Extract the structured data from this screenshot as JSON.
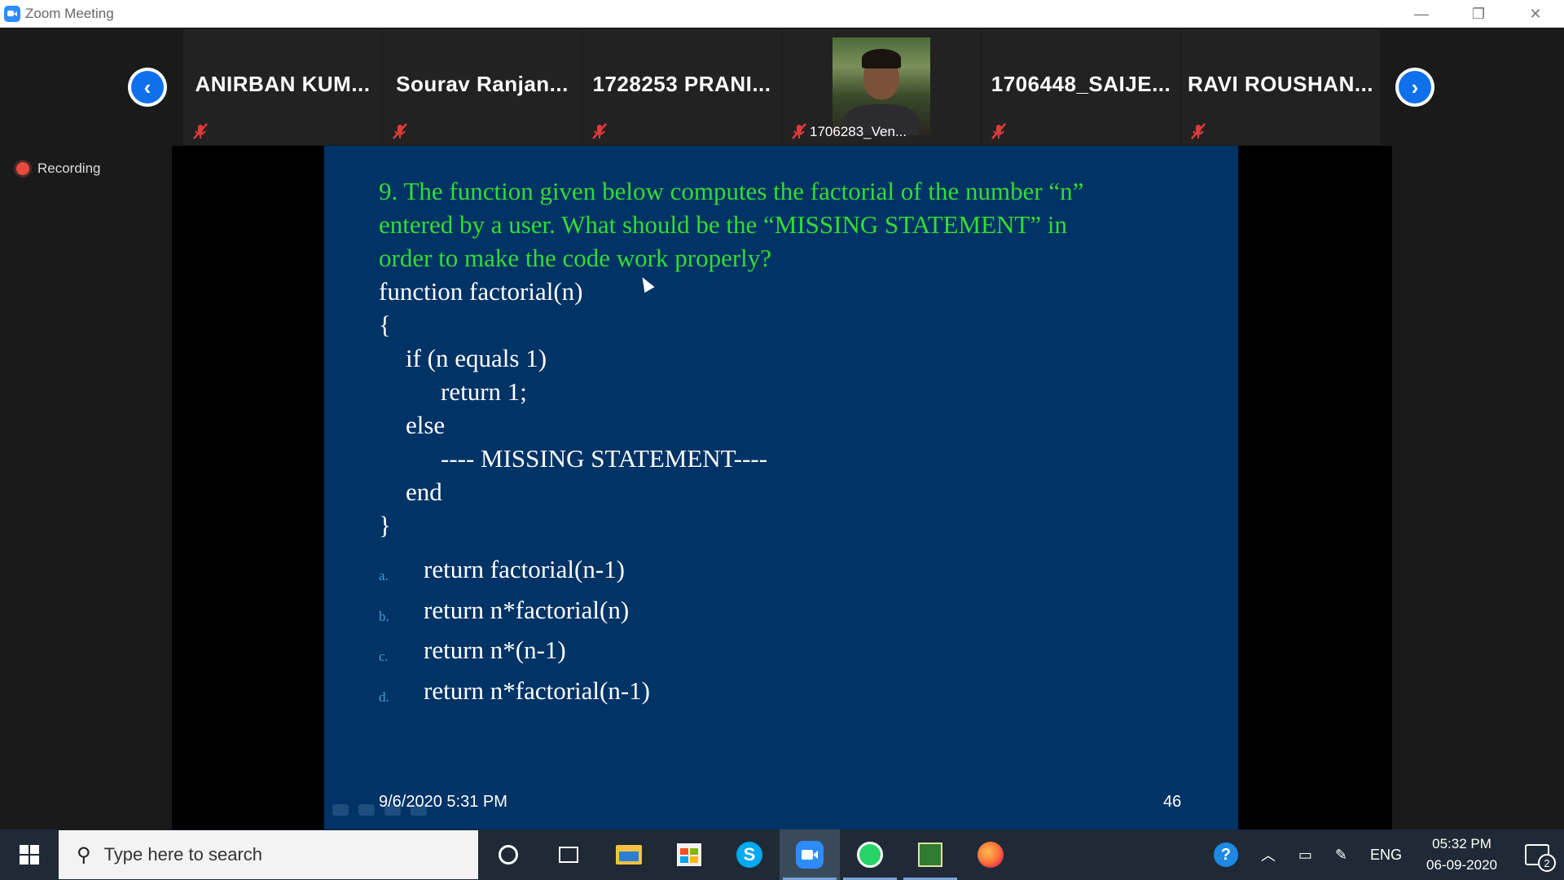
{
  "window": {
    "title": "Zoom Meeting",
    "controls": {
      "minimize": "—",
      "restore": "❐",
      "close": "✕"
    }
  },
  "strip": {
    "prev_arrow": "‹",
    "next_arrow": "›",
    "participants": [
      {
        "name": "ANIRBAN KUM...",
        "muted": true
      },
      {
        "name": "Sourav Ranjan...",
        "muted": true
      },
      {
        "name": "1728253 PRANI...",
        "muted": true
      },
      {
        "name": "1706283_Ven...",
        "muted": true,
        "has_video": true
      },
      {
        "name": "1706448_SAIJE...",
        "muted": true
      },
      {
        "name": "RAVI ROUSHAN...",
        "muted": true
      }
    ]
  },
  "recording": {
    "label": "Recording"
  },
  "slide": {
    "question_lines": [
      "9. The function given below computes the factorial of the number “n”",
      "entered by a user. What should be the “MISSING STATEMENT” in",
      "order to make the code work properly?"
    ],
    "code_lines": [
      "function factorial(n)",
      "{",
      "if (n equals 1)",
      "return 1;",
      "else",
      "---- MISSING STATEMENT----",
      "end",
      "}"
    ],
    "options": [
      {
        "letter": "a.",
        "text": "return factorial(n-1)"
      },
      {
        "letter": "b.",
        "text": "return n*factorial(n)"
      },
      {
        "letter": "c.",
        "text": "return n*(n-1)"
      },
      {
        "letter": "d.",
        "text": "return n*factorial(n-1)"
      }
    ],
    "footer_date": "9/6/2020 5:31 PM",
    "slide_number": "46"
  },
  "taskbar": {
    "search_placeholder": "Type here to search",
    "language": "ENG",
    "time": "05:32 PM",
    "date": "06-09-2020",
    "notification_count": "2",
    "apps": [
      "cortana-icon",
      "task-view-icon",
      "file-explorer-icon",
      "store-icon",
      "skype-icon",
      "zoom-icon",
      "whatsapp-icon",
      "notepad-icon",
      "firefox-icon"
    ]
  },
  "colors": {
    "slide_bg": "#003366",
    "question_text": "#33dd33",
    "zoom_blue": "#0e71eb",
    "mute_red": "#e03a3a",
    "taskbar_bg": "#1f2a36"
  }
}
